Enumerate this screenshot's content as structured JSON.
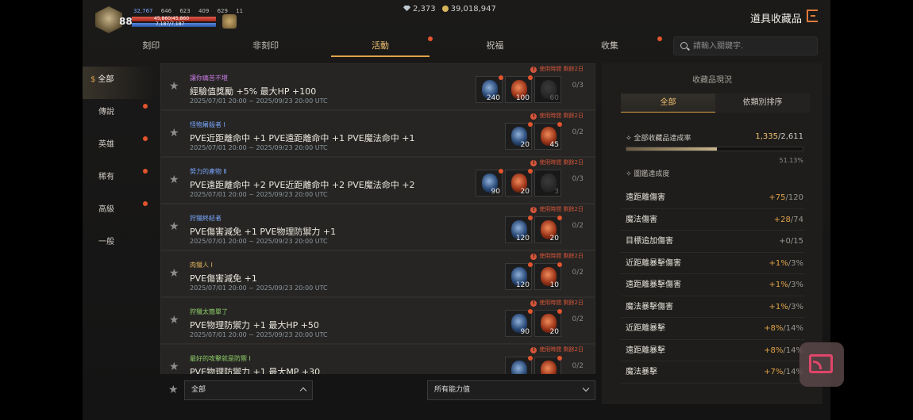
{
  "header": {
    "level": "88",
    "stats": {
      "hp_score": "32,767",
      "a": "646",
      "b": "623",
      "c": "409",
      "d": "629",
      "e": "11"
    },
    "hp_text": "45,860/45,860",
    "mp_text": "7,187/7,187",
    "gems": "2,373",
    "gold": "39,018,947",
    "title": "道具收藏品"
  },
  "tabs": [
    {
      "label": "刻印",
      "dot": false
    },
    {
      "label": "非刻印",
      "dot": false
    },
    {
      "label": "活動",
      "dot": true,
      "active": true
    },
    {
      "label": "祝福",
      "dot": false
    },
    {
      "label": "收集",
      "dot": true
    }
  ],
  "search": {
    "placeholder": "請輸入關鍵字."
  },
  "categories": [
    {
      "label": "全部",
      "active": true,
      "dot": false
    },
    {
      "label": "傳說",
      "dot": true
    },
    {
      "label": "英雄",
      "dot": true
    },
    {
      "label": "稀有",
      "dot": true
    },
    {
      "label": "高級",
      "dot": true
    },
    {
      "label": "一般",
      "dot": false
    }
  ],
  "collections": [
    {
      "name": "讓你痛苦不堪",
      "name_color": "#c67ae0",
      "effect": "經驗值獎勵 +5% 最大HP +100",
      "period": "2025/07/01 20:00 ~ 2025/09/23 20:00 UTC",
      "timer": "使用時間 剩餘2日",
      "progress": "0/3",
      "items": [
        {
          "type": "blue",
          "count": "240"
        },
        {
          "type": "orange",
          "count": "100"
        },
        {
          "type": "empty",
          "count": "60"
        }
      ]
    },
    {
      "name": "怪物屠殺者 Ⅰ",
      "name_color": "#7aa7ff",
      "effect": "PVE近距離命中 +1 PVE遠距離命中 +1 PVE魔法命中 +1",
      "period": "2025/07/01 20:00 ~ 2025/09/23 20:00 UTC",
      "timer": "使用時間 剩餘2日",
      "progress": "0/2",
      "items": [
        {
          "type": "blue",
          "count": "20"
        },
        {
          "type": "orange",
          "count": "45"
        }
      ]
    },
    {
      "name": "努力的產物 Ⅱ",
      "name_color": "#7aa7ff",
      "effect": "PVE遠距離命中 +2 PVE近距離命中 +2 PVE魔法命中 +2",
      "period": "2025/07/01 20:00 ~ 2025/09/23 20:00 UTC",
      "timer": "使用時間 剩餘2日",
      "progress": "0/3",
      "items": [
        {
          "type": "blue",
          "count": "90"
        },
        {
          "type": "orange",
          "count": "20"
        },
        {
          "type": "empty",
          "count": "3"
        }
      ]
    },
    {
      "name": "狩獵終結者",
      "name_color": "#7aa7ff",
      "effect": "PVE傷害減免 +1 PVE物理防禦力 +1",
      "period": "2025/07/01 20:00 ~ 2025/09/23 20:00 UTC",
      "timer": "使用時間 剩餘2日",
      "progress": "0/2",
      "items": [
        {
          "type": "blue",
          "count": "120"
        },
        {
          "type": "orange",
          "count": "20"
        }
      ]
    },
    {
      "name": "肉獵人 Ⅰ",
      "name_color": "#e0b25a",
      "effect": "PVE傷害減免 +1",
      "period": "2025/07/01 20:00 ~ 2025/09/23 20:00 UTC",
      "timer": "使用時間 剩餘2日",
      "progress": "0/2",
      "items": [
        {
          "type": "blue",
          "count": "120"
        },
        {
          "type": "orange",
          "count": "10"
        }
      ]
    },
    {
      "name": "狩獵太簡單了",
      "name_color": "#8fcf6a",
      "effect": "PVE物理防禦力 +1 最大HP +50",
      "period": "2025/07/01 20:00 ~ 2025/09/23 20:00 UTC",
      "timer": "使用時間 剩餘2日",
      "progress": "0/2",
      "items": [
        {
          "type": "blue",
          "count": "90"
        },
        {
          "type": "orange",
          "count": "20"
        }
      ]
    },
    {
      "name": "最好的攻擊就是防禦 Ⅰ",
      "name_color": "#8fcf6a",
      "effect": "PVE物理防禦力 +1 最大MP +30",
      "period": "",
      "timer": "使用時間 剩餘2日",
      "progress": "0/2",
      "items": [
        {
          "type": "blue",
          "count": ""
        },
        {
          "type": "orange",
          "count": ""
        }
      ]
    }
  ],
  "filters": {
    "left": "全部",
    "right": "所有能力值"
  },
  "panel": {
    "title": "收藏品現況",
    "tabs": [
      {
        "label": "全部",
        "active": true
      },
      {
        "label": "依類別排序"
      }
    ],
    "overall_label": "全部收藏品達成率",
    "overall_current": "1,335",
    "overall_total": "/2,611",
    "overall_percent": "51.13%",
    "overall_fraction": 0.5113,
    "sub_label": "圖鑑達成度",
    "stats": [
      {
        "name": "遠距離傷害",
        "cur": "+75",
        "max": "/120"
      },
      {
        "name": "魔法傷害",
        "cur": "+28",
        "max": "/74"
      },
      {
        "name": "目標追加傷害",
        "cur": "+0",
        "max": "/15",
        "zero": true
      },
      {
        "name": "近距離暴擊傷害",
        "cur": "+1%",
        "max": "/3%"
      },
      {
        "name": "遠距離暴擊傷害",
        "cur": "+1%",
        "max": "/3%"
      },
      {
        "name": "魔法暴擊傷害",
        "cur": "+1%",
        "max": "/3%"
      },
      {
        "name": "近距離暴擊",
        "cur": "+8%",
        "max": "/14%"
      },
      {
        "name": "遠距離暴擊",
        "cur": "+8%",
        "max": "/14%"
      },
      {
        "name": "魔法暴擊",
        "cur": "+7%",
        "max": "/14%"
      }
    ]
  }
}
